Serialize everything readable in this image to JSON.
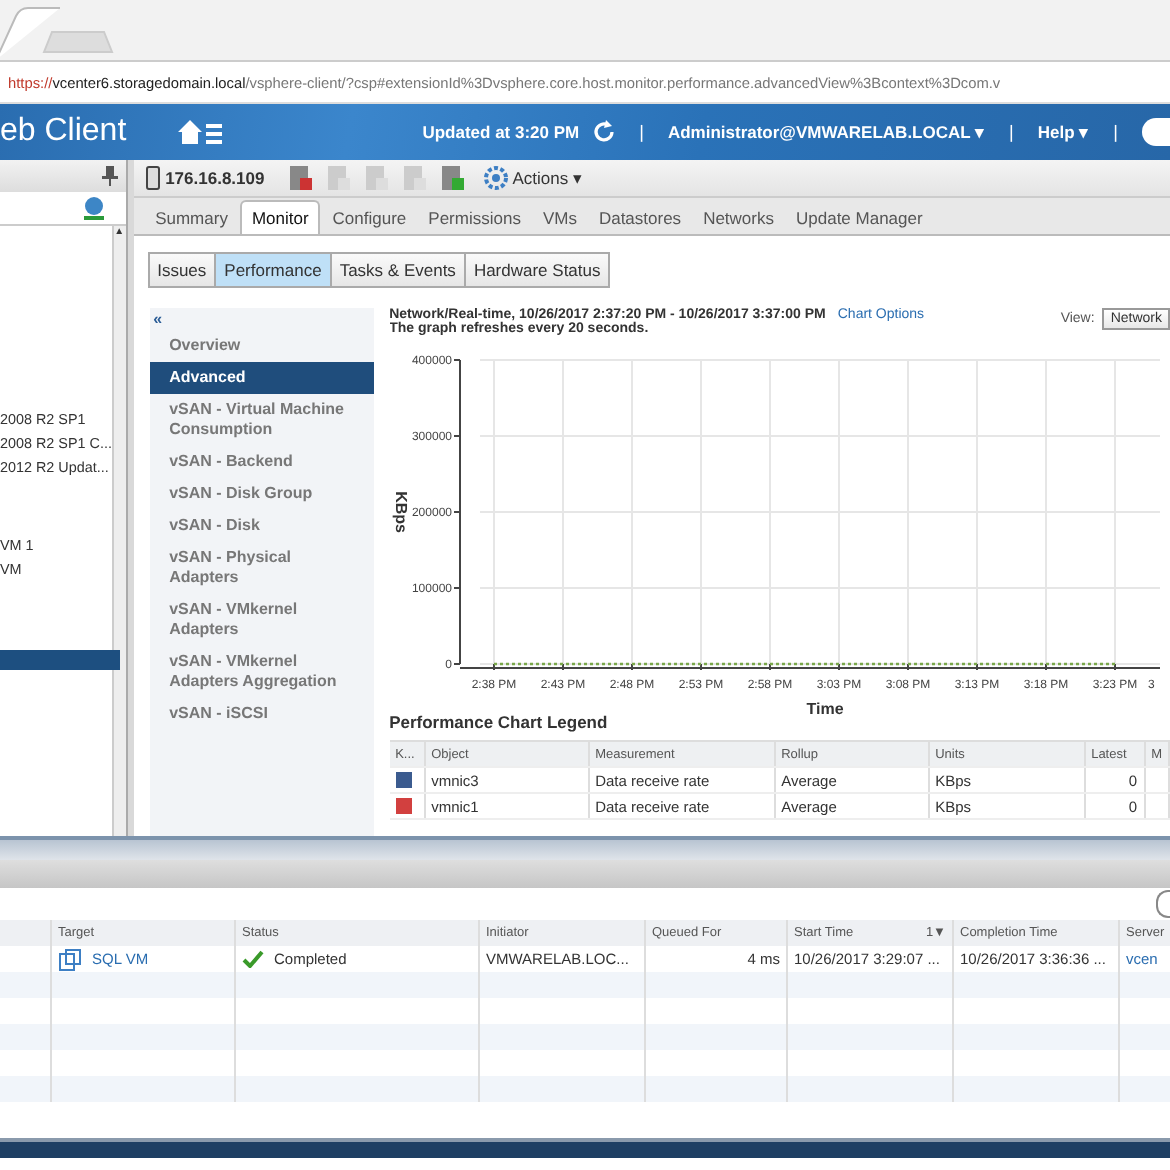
{
  "browser": {
    "url_scheme": "https://",
    "url_host": "vcenter6.storagedomain.local",
    "url_path": "/vsphere-client/?csp#extensionId%3Dvsphere.core.host.monitor.performance.advancedView%3Bcontext%3Dcom.v"
  },
  "header": {
    "app_title": "eb Client",
    "updated": "Updated at 3:20 PM",
    "separator": "|",
    "user": "Administrator@VMWARELAB.LOCAL",
    "caret": "▾",
    "help": "Help"
  },
  "navigator": {
    "scroll_arrow": "▲",
    "items": [
      {
        "label": "2008 R2 SP1",
        "selected": false
      },
      {
        "label": "2008 R2 SP1 C...",
        "selected": false
      },
      {
        "label": "2012 R2 Updat...",
        "selected": false
      },
      {
        "label": "VM 1",
        "selected": false
      },
      {
        "label": "VM",
        "selected": false
      },
      {
        "selected": true
      }
    ]
  },
  "object": {
    "name": "176.16.8.109",
    "actions": "Actions",
    "caret": "▾"
  },
  "tabs": [
    {
      "label": "Summary",
      "selected": false
    },
    {
      "label": "Monitor",
      "selected": true
    },
    {
      "label": "Configure",
      "selected": false
    },
    {
      "label": "Permissions",
      "selected": false
    },
    {
      "label": "VMs",
      "selected": false
    },
    {
      "label": "Datastores",
      "selected": false
    },
    {
      "label": "Networks",
      "selected": false
    },
    {
      "label": "Update Manager",
      "selected": false
    }
  ],
  "subtabs": [
    {
      "label": "Issues",
      "selected": false
    },
    {
      "label": "Performance",
      "selected": true
    },
    {
      "label": "Tasks & Events",
      "selected": false
    },
    {
      "label": "Hardware Status",
      "selected": false
    }
  ],
  "perf_menu": {
    "collapse": "«",
    "items": [
      {
        "label": "Overview",
        "selected": false
      },
      {
        "label": "Advanced",
        "selected": true
      },
      {
        "label": "vSAN - Virtual Machine Consumption",
        "selected": false
      },
      {
        "label": "vSAN - Backend",
        "selected": false
      },
      {
        "label": "vSAN - Disk Group",
        "selected": false
      },
      {
        "label": "vSAN - Disk",
        "selected": false
      },
      {
        "label": "vSAN - Physical Adapters",
        "selected": false
      },
      {
        "label": "vSAN - VMkernel Adapters",
        "selected": false
      },
      {
        "label": "vSAN - VMkernel Adapters Aggregation",
        "selected": false
      },
      {
        "label": "vSAN - iSCSI",
        "selected": false
      }
    ]
  },
  "chart_header": {
    "range": "Network/Real-time, 10/26/2017 2:37:20 PM - 10/26/2017 3:37:00 PM",
    "options_link": "Chart Options",
    "refresh": "The graph refreshes every 20 seconds.",
    "view_label": "View:",
    "view_value": "Network"
  },
  "chart_data": {
    "type": "line",
    "xlabel": "Time",
    "ylabel": "KBps",
    "grid": true,
    "categories": [
      "2:38 PM",
      "2:43 PM",
      "2:48 PM",
      "2:53 PM",
      "2:58 PM",
      "3:03 PM",
      "3:08 PM",
      "3:13 PM",
      "3:18 PM",
      "3:23 PM",
      "3"
    ],
    "series": [
      {
        "color": "#7aa84a",
        "line_style": "dotted",
        "values": [
          0,
          0,
          0,
          0,
          0,
          0,
          0,
          0,
          0,
          0,
          null
        ]
      }
    ],
    "ylim": [
      0,
      400000
    ],
    "yticks": [
      0,
      100000,
      200000,
      300000,
      400000
    ]
  },
  "legend": {
    "title": "Performance Chart Legend",
    "columns": [
      "K...",
      "Object",
      "Measurement",
      "Rollup",
      "Units",
      "Latest",
      "M"
    ],
    "rows": [
      {
        "color": "#3b5b8f",
        "object": "vmnic3",
        "measurement": "Data receive rate",
        "rollup": "Average",
        "units": "KBps",
        "latest": "0"
      },
      {
        "color": "#d2403f",
        "object": "vmnic1",
        "measurement": "Data receive rate",
        "rollup": "Average",
        "units": "KBps",
        "latest": "0"
      }
    ]
  },
  "tasks": {
    "columns": [
      "",
      "Target",
      "Status",
      "Initiator",
      "Queued For",
      "Start Time",
      "Completion Time",
      "Server"
    ],
    "sort_mark": "1▼",
    "rows": [
      {
        "target": "SQL VM",
        "status": "Completed",
        "initiator": "VMWARELAB.LOC...",
        "queued": "4 ms",
        "start": "10/26/2017 3:29:07 ...",
        "completion": "10/26/2017 3:36:36 ...",
        "server": "vcen"
      }
    ]
  }
}
